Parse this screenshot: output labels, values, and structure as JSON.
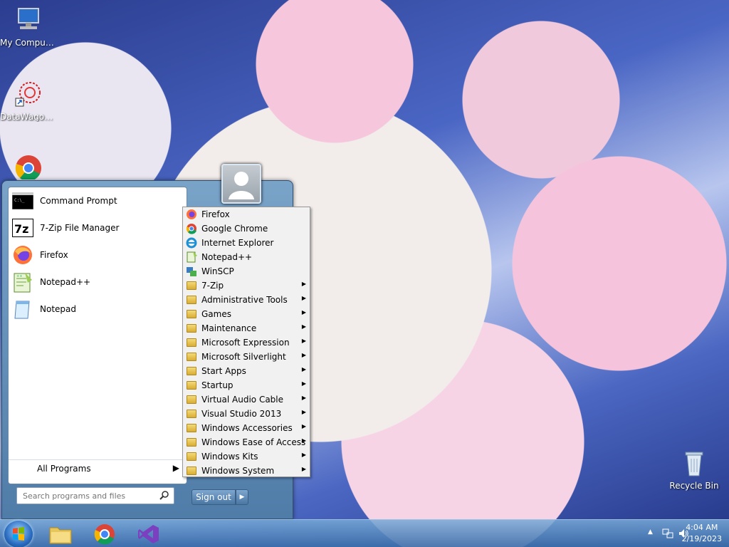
{
  "desktop": {
    "icons": [
      {
        "label": "My Computer",
        "icon": "computer-icon"
      },
      {
        "label": "DataWagon...",
        "icon": "datawagon-shortcut-icon"
      },
      {
        "label": "Google Chrome",
        "icon": "chrome-icon"
      },
      {
        "label": "Recycle Bin",
        "icon": "recycle-bin-icon"
      }
    ]
  },
  "start_menu": {
    "pinned": [
      {
        "label": "Command Prompt",
        "icon": "cmd-icon"
      },
      {
        "label": "7-Zip File Manager",
        "icon": "7zip-icon"
      },
      {
        "label": "Firefox",
        "icon": "firefox-icon"
      },
      {
        "label": "Notepad++",
        "icon": "notepadpp-icon"
      },
      {
        "label": "Notepad",
        "icon": "notepad-icon"
      }
    ],
    "all_programs": "All Programs",
    "search_placeholder": "Search programs and files",
    "sign_out": "Sign out"
  },
  "programs": [
    {
      "label": "Firefox",
      "icon": "firefox-icon",
      "submenu": false
    },
    {
      "label": "Google Chrome",
      "icon": "chrome-icon",
      "submenu": false
    },
    {
      "label": "Internet Explorer",
      "icon": "ie-icon",
      "submenu": false
    },
    {
      "label": "Notepad++",
      "icon": "notepadpp-icon",
      "submenu": false
    },
    {
      "label": "WinSCP",
      "icon": "winscp-icon",
      "submenu": false
    },
    {
      "label": "7-Zip",
      "icon": "folder-icon",
      "submenu": true
    },
    {
      "label": "Administrative Tools",
      "icon": "folder-icon",
      "submenu": true
    },
    {
      "label": "Games",
      "icon": "folder-icon",
      "submenu": true
    },
    {
      "label": "Maintenance",
      "icon": "folder-icon",
      "submenu": true
    },
    {
      "label": "Microsoft Expression",
      "icon": "folder-icon",
      "submenu": true
    },
    {
      "label": "Microsoft Silverlight",
      "icon": "folder-icon",
      "submenu": true
    },
    {
      "label": "Start Apps",
      "icon": "folder-icon",
      "submenu": true
    },
    {
      "label": "Startup",
      "icon": "folder-icon",
      "submenu": true
    },
    {
      "label": "Virtual Audio Cable",
      "icon": "folder-icon",
      "submenu": true
    },
    {
      "label": "Visual Studio 2013",
      "icon": "folder-icon",
      "submenu": true
    },
    {
      "label": "Windows Accessories",
      "icon": "folder-icon",
      "submenu": true
    },
    {
      "label": "Windows Ease of Access",
      "icon": "folder-icon",
      "submenu": true
    },
    {
      "label": "Windows Kits",
      "icon": "folder-icon",
      "submenu": true
    },
    {
      "label": "Windows System",
      "icon": "folder-icon",
      "submenu": true
    }
  ],
  "taskbar": {
    "pinned": [
      "explorer-icon",
      "chrome-icon",
      "visual-studio-icon"
    ],
    "clock": {
      "time": "4:04 AM",
      "date": "2/19/2023"
    }
  }
}
